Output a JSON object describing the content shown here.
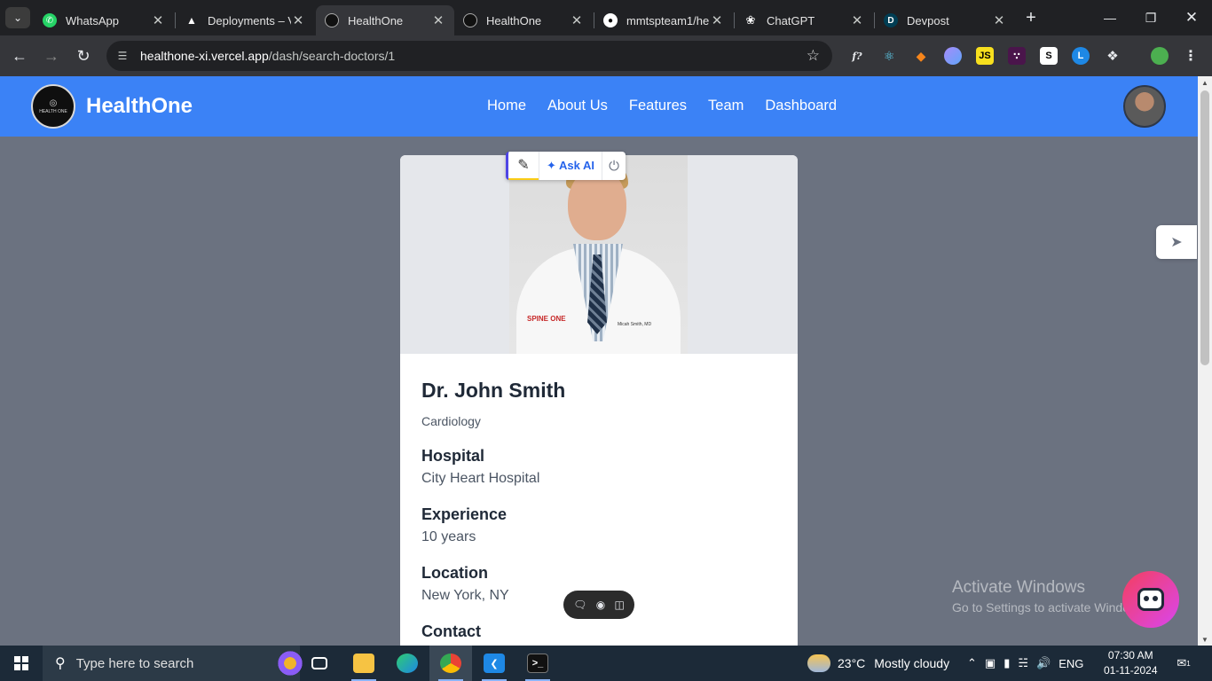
{
  "browser": {
    "tabs": [
      {
        "title": "WhatsApp",
        "icon": "whatsapp-icon"
      },
      {
        "title": "Deployments – V",
        "icon": "vercel-icon"
      },
      {
        "title": "HealthOne",
        "icon": "healthone-icon",
        "active": true
      },
      {
        "title": "HealthOne",
        "icon": "healthone-icon"
      },
      {
        "title": "mmtspteam1/he",
        "icon": "github-icon"
      },
      {
        "title": "ChatGPT",
        "icon": "chatgpt-icon"
      },
      {
        "title": "Devpost",
        "icon": "devpost-icon"
      }
    ],
    "url_host": "healthone-xi.vercel.app",
    "url_path": "/dash/search-doctors/1"
  },
  "site": {
    "brand": "HealthOne",
    "logo_text": "HEALTH ONE",
    "nav": [
      "Home",
      "About Us",
      "Features",
      "Team",
      "Dashboard"
    ]
  },
  "doctor": {
    "name": "Dr. John Smith",
    "specialty": "Cardiology",
    "hospital_label": "Hospital",
    "hospital": "City Heart Hospital",
    "experience_label": "Experience",
    "experience": "10 years",
    "location_label": "Location",
    "location": "New York, NY",
    "contact_label": "Contact"
  },
  "overlay": {
    "ask_ai": "✦ Ask AI"
  },
  "watermark": {
    "line1": "Activate Windows",
    "line2": "Go to Settings to activate Windows."
  },
  "taskbar": {
    "search_placeholder": "Type here to search",
    "temperature": "23°C",
    "condition": "Mostly cloudy",
    "language": "ENG",
    "time": "07:30 AM",
    "date": "01-11-2024",
    "notification_count": "1"
  },
  "colors": {
    "header_bg": "#3b82f6",
    "page_bg": "#6b7280",
    "card_bg": "#ffffff"
  }
}
